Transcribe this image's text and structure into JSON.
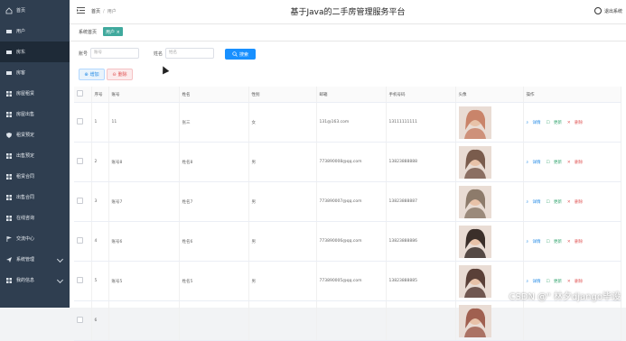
{
  "sidebar": {
    "items": [
      {
        "label": "首页",
        "icon": "home-icon"
      },
      {
        "label": "用户",
        "icon": "user-icon"
      },
      {
        "label": "房东",
        "icon": "landlord-icon",
        "active": true
      },
      {
        "label": "房客",
        "icon": "tenant-icon"
      },
      {
        "label": "房屋租赁",
        "icon": "grid-icon"
      },
      {
        "label": "房屋出售",
        "icon": "grid-icon"
      },
      {
        "label": "租赁预定",
        "icon": "shield-icon"
      },
      {
        "label": "出售预定",
        "icon": "grid-icon"
      },
      {
        "label": "租赁合同",
        "icon": "grid-icon"
      },
      {
        "label": "出售合同",
        "icon": "grid-icon"
      },
      {
        "label": "在线咨询",
        "icon": "grid-icon"
      },
      {
        "label": "交流中心",
        "icon": "flag-icon"
      },
      {
        "label": "系统管理",
        "icon": "send-icon",
        "expandable": true
      },
      {
        "label": "我的信息",
        "icon": "grid-icon",
        "expandable": true
      }
    ]
  },
  "topbar": {
    "breadcrumb_home": "首页",
    "breadcrumb_current": "用户",
    "title": "基于Java的二手房管理服务平台",
    "logout": "退出系统"
  },
  "tags": {
    "home": "系统首页",
    "active": "用户 ×"
  },
  "search": {
    "account_label": "账号",
    "account_placeholder": "账号",
    "name_label": "姓名",
    "name_placeholder": "姓名",
    "button": "搜索"
  },
  "actions": {
    "add": "增加",
    "delete": "删除"
  },
  "table": {
    "headers": [
      "",
      "序号",
      "账号",
      "姓名",
      "性别",
      "邮箱",
      "手机号码",
      "头像",
      "操作"
    ],
    "op_labels": {
      "detail": "详情",
      "update": "更新",
      "delete": "删除"
    },
    "rows": [
      {
        "index": "1",
        "account": "11",
        "name": "张三",
        "gender": "女",
        "email": "131@163.com",
        "phone": "13111111111",
        "avatar_color": "#c9846a"
      },
      {
        "index": "2",
        "account": "账号8",
        "name": "姓名8",
        "gender": "男",
        "email": "773890008@qq.com",
        "phone": "13823888888",
        "avatar_color": "#7a5c4d"
      },
      {
        "index": "3",
        "account": "账号7",
        "name": "姓名7",
        "gender": "男",
        "email": "773890007@qq.com",
        "phone": "13823888887",
        "avatar_color": "#8d7b6b"
      },
      {
        "index": "4",
        "account": "账号6",
        "name": "姓名6",
        "gender": "男",
        "email": "773890006@qq.com",
        "phone": "13823888886",
        "avatar_color": "#3b2f2a"
      },
      {
        "index": "5",
        "account": "账号5",
        "name": "姓名5",
        "gender": "男",
        "email": "773890005@qq.com",
        "phone": "13823888885",
        "avatar_color": "#5a4038"
      },
      {
        "index": "6",
        "account": "",
        "name": "",
        "gender": "",
        "email": "",
        "phone": "",
        "avatar_color": "#a06050"
      }
    ]
  },
  "watermark": "CSDN @\" 林夕django毕设"
}
